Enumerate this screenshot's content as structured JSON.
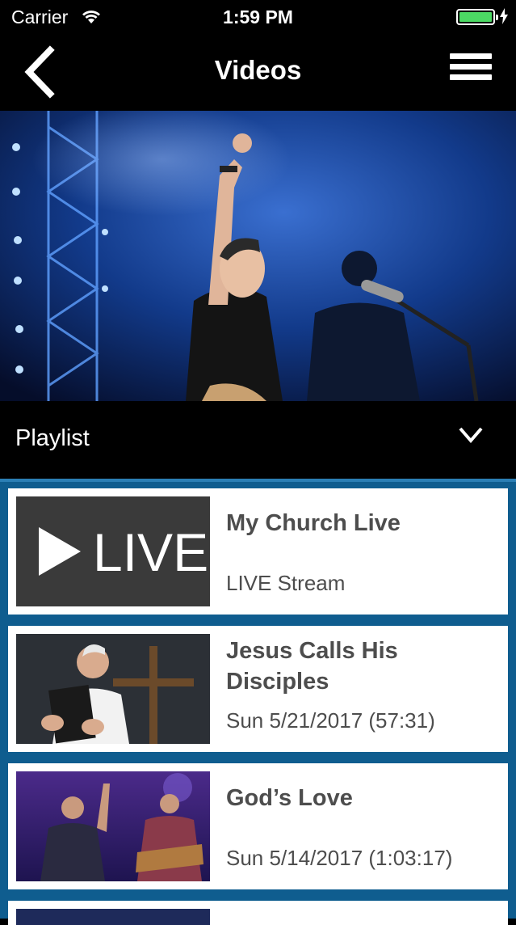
{
  "status_bar": {
    "carrier": "Carrier",
    "time": "1:59 PM"
  },
  "nav": {
    "title": "Videos",
    "back_icon": "chevron-left-icon",
    "menu_icon": "hamburger-menu-icon"
  },
  "hero": {
    "description": "concert worship leader photo"
  },
  "playlist": {
    "label": "Playlist",
    "icon": "chevron-down-icon"
  },
  "videos": [
    {
      "title": "My Church Live",
      "subtitle": "LIVE Stream",
      "thumb_text": "LIVE"
    },
    {
      "title": "Jesus Calls His Disciples",
      "subtitle": "Sun 5/21/2017 (57:31)"
    },
    {
      "title": "God’s Love",
      "subtitle": "Sun 5/14/2017 (1:03:17)"
    }
  ],
  "colors": {
    "list_background": "#0f5d8f",
    "battery": "#4cd964"
  }
}
